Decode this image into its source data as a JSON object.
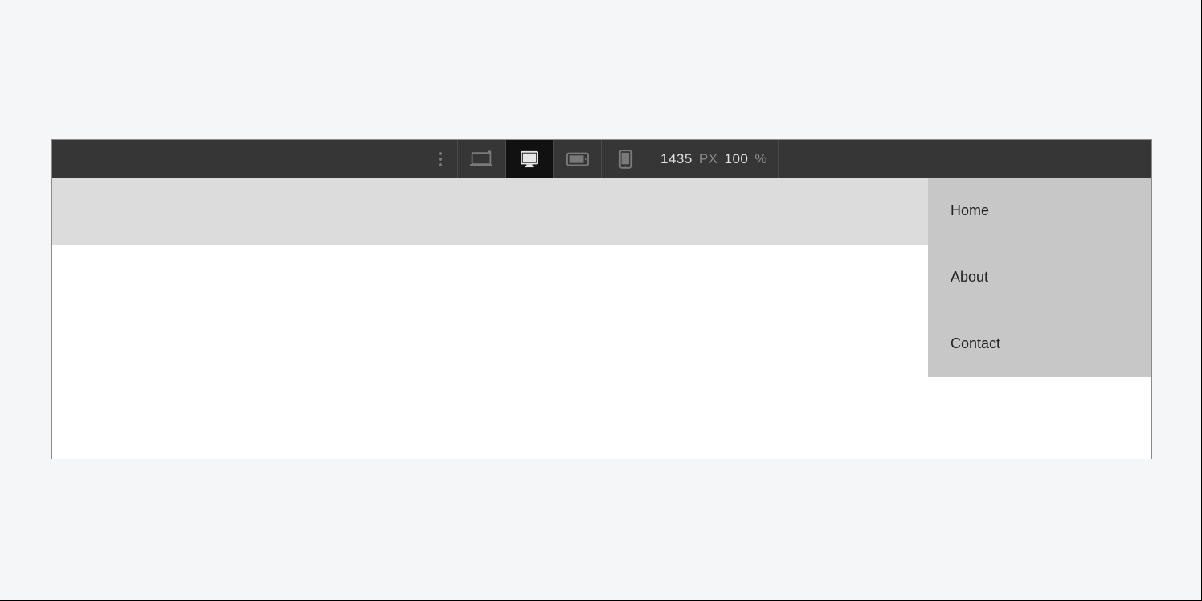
{
  "toolbar": {
    "width_value": "1435",
    "width_unit": "PX",
    "zoom_value": "100",
    "zoom_unit": "%"
  },
  "nav": {
    "items": [
      {
        "label": "Home"
      },
      {
        "label": "About"
      },
      {
        "label": "Contact"
      }
    ]
  }
}
